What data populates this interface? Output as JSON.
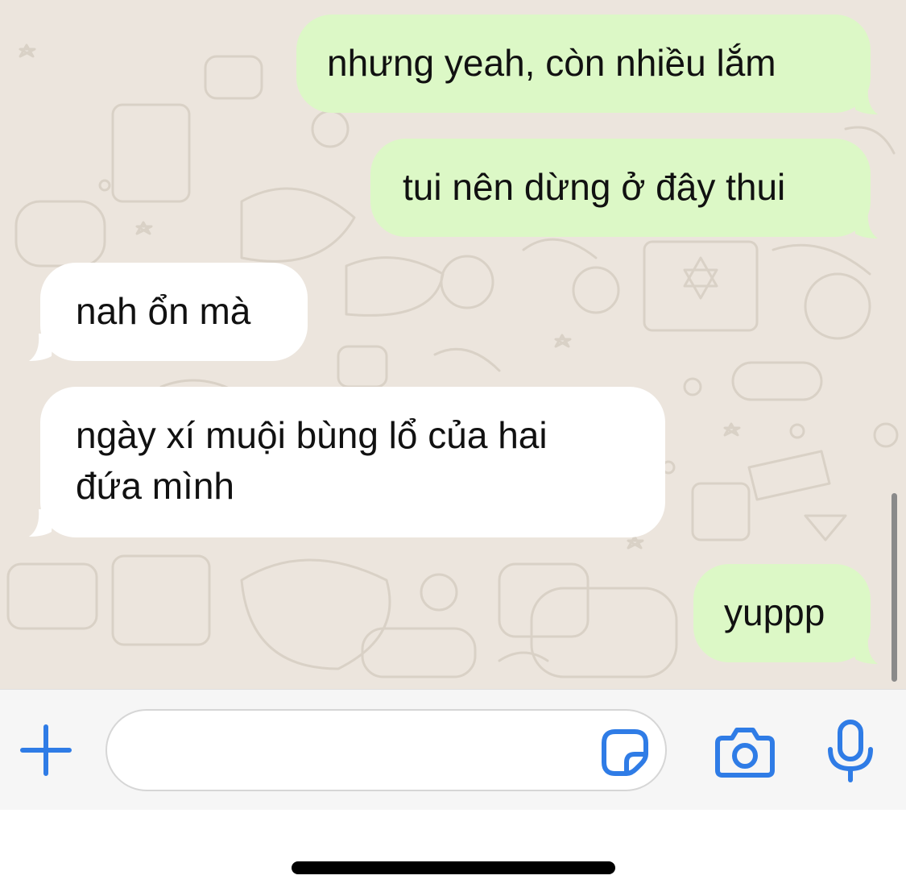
{
  "colors": {
    "accent": "#2f7ce6",
    "outgoing_bubble": "#dcf8c6",
    "incoming_bubble": "#ffffff",
    "chat_background": "#ece5dd",
    "input_bar": "#f6f6f6"
  },
  "messages": [
    {
      "direction": "outgoing",
      "lines": [
        "nhưng yeah, còn nhiều lắm"
      ]
    },
    {
      "direction": "outgoing",
      "lines": [
        "tui nên dừng ở đây thui"
      ]
    },
    {
      "direction": "incoming",
      "lines": [
        "nah ổn mà"
      ]
    },
    {
      "direction": "incoming",
      "lines": [
        "ngày xí muội bùng lổ của hai",
        "đứa mình"
      ]
    },
    {
      "direction": "outgoing",
      "lines": [
        "yuppp"
      ]
    }
  ],
  "composer": {
    "placeholder": "",
    "value": "",
    "icons": {
      "plus": "plus-icon",
      "sticker": "sticker-icon",
      "camera": "camera-icon",
      "mic": "microphone-icon"
    }
  }
}
